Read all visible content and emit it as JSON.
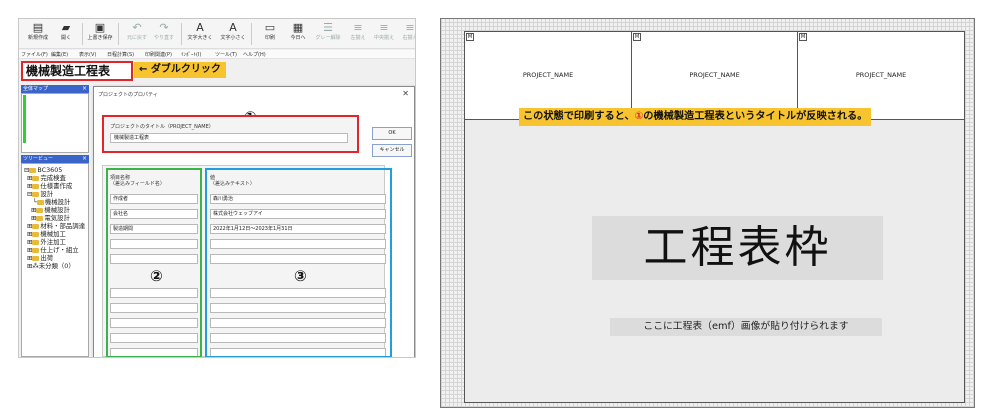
{
  "toolbar": {
    "buttons": [
      {
        "label": "新規作成",
        "icon": "new-doc-icon",
        "glyph": "▤",
        "enabled": true
      },
      {
        "label": "開く",
        "icon": "open-folder-icon",
        "glyph": "▰",
        "enabled": true
      },
      {
        "label": "上書き保存",
        "icon": "save-icon",
        "glyph": "▣",
        "enabled": true
      },
      {
        "label": "元に戻す",
        "icon": "undo-icon",
        "glyph": "↶",
        "enabled": false
      },
      {
        "label": "やり直す",
        "icon": "redo-icon",
        "glyph": "↷",
        "enabled": false
      },
      {
        "label": "文字大きく",
        "icon": "font-larger-icon",
        "glyph": "A",
        "enabled": true
      },
      {
        "label": "文字小さく",
        "icon": "font-smaller-icon",
        "glyph": "A",
        "enabled": true
      },
      {
        "label": "印刷",
        "icon": "print-icon",
        "glyph": "▭",
        "enabled": true
      },
      {
        "label": "今日へ",
        "icon": "today-icon",
        "glyph": "▦",
        "enabled": true
      },
      {
        "label": "グレー解除",
        "icon": "gray-clear-icon",
        "glyph": "☰",
        "enabled": false
      },
      {
        "label": "左揃え",
        "icon": "align-left-icon",
        "glyph": "≡",
        "enabled": false
      },
      {
        "label": "中央揃え",
        "icon": "align-center-icon",
        "glyph": "≡",
        "enabled": false
      },
      {
        "label": "右揃え",
        "icon": "align-right-icon",
        "glyph": "≡",
        "enabled": false
      }
    ]
  },
  "menu": [
    "ファイル(F)",
    "編集(E)",
    "表示(V)",
    "日程計算(S)",
    "印刷関連(P)",
    "ｲﾝﾎﾟｰﾄ(I)",
    "ツール(T)",
    "ヘルプ(H)"
  ],
  "title_field": {
    "value": "機械製造工程表"
  },
  "annotation_left": {
    "text": "← ダブルクリック"
  },
  "panels": {
    "overview": {
      "title": "全体マップ"
    },
    "tree": {
      "title": "ツリービュー"
    }
  },
  "tree": {
    "items": [
      "BC3605",
      "完成検査",
      "仕様書作成",
      "設計",
      "機械設計",
      "電気設計",
      "材料・部品調達",
      "機械加工",
      "外注加工",
      "仕上げ・組立",
      "出荷",
      "未分類（0）"
    ]
  },
  "dialog": {
    "title": "プロジェクトのプロパティ",
    "ok_label": "OK",
    "cancel_label": "キャンセル",
    "project_title_label": "プロジェクトのタイトル（PROJECT_NAME）",
    "project_title_value": "機械製造工程表",
    "field_name_header": "項目名称",
    "field_name_sub": "（差込みフィールド名）",
    "value_header": "値",
    "value_sub": "（差込みテキスト）",
    "rows": [
      {
        "name": "作成者",
        "value": "森川勇治"
      },
      {
        "name": "会社名",
        "value": "株式会社ウェッブアイ"
      },
      {
        "name": "製造期間",
        "value": "2022年1月12日～2023年1月31日"
      },
      {
        "name": "",
        "value": ""
      },
      {
        "name": "",
        "value": ""
      },
      {
        "name": "",
        "value": ""
      },
      {
        "name": "",
        "value": ""
      },
      {
        "name": "",
        "value": ""
      },
      {
        "name": "",
        "value": ""
      },
      {
        "name": "",
        "value": ""
      }
    ]
  },
  "markers": {
    "m1": "①",
    "m2": "②",
    "m3": "③"
  },
  "colors": {
    "red": "#e0262c",
    "green": "#3ab44a",
    "blue": "#1f9fdc",
    "yellow": "#f7c32e",
    "title_blue": "#3a64c8"
  },
  "template": {
    "header_cells": [
      "PROJECT_NAME",
      "PROJECT_NAME",
      "PROJECT_NAME"
    ],
    "header_mini": "M",
    "note_before": "この状態で印刷すると、",
    "note_num": "①",
    "note_after": "の機械製造工程表というタイトルが反映される。",
    "big_title": "工程表枠",
    "caption": "ここに工程表（emf）画像が貼り付けられます"
  }
}
